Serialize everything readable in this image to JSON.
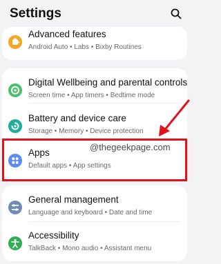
{
  "header": {
    "title": "Settings",
    "search_icon": "search-icon"
  },
  "items": [
    {
      "title": "Advanced features",
      "subtitle": "Android Auto  •  Labs  •  Bixby Routines",
      "icon": "puzzle-icon",
      "color": "#f5a623"
    },
    {
      "title": "Digital Wellbeing and parental controls",
      "subtitle": "Screen time  •  App timers  •  Bedtime mode",
      "icon": "wellbeing-icon",
      "color": "#4cbf6b"
    },
    {
      "title": "Battery and device care",
      "subtitle": "Storage  •  Memory  •  Device protection",
      "icon": "device-care-icon",
      "color": "#1fae9a"
    },
    {
      "title": "Apps",
      "subtitle": "Default apps  •  App settings",
      "icon": "apps-icon",
      "color": "#5b8cf0"
    },
    {
      "title": "General management",
      "subtitle": "Language and keyboard  •  Date and time",
      "icon": "sliders-icon",
      "color": "#6f8db3"
    },
    {
      "title": "Accessibility",
      "subtitle": "TalkBack  •  Mono audio  •  Assistant menu",
      "icon": "accessibility-icon",
      "color": "#2fae55"
    }
  ],
  "watermark": "@thegeekpage.com",
  "annotation": {
    "highlight_color": "#e5101a"
  }
}
